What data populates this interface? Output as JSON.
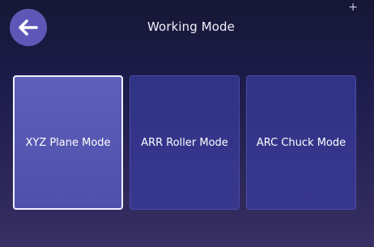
{
  "app": {
    "title": "Working Mode"
  },
  "header": {
    "back_button": {
      "icon": "back-arrow-icon"
    },
    "corner_mark": "+"
  },
  "modes": [
    {
      "label": "XYZ Plane Mode",
      "selected": true
    },
    {
      "label": "ARR Roller Mode",
      "selected": false
    },
    {
      "label": "ARC Chuck Mode",
      "selected": false
    }
  ],
  "colors": {
    "background_top": "#161736",
    "background_bottom": "#392f64",
    "accent": "#5f57b8",
    "card_selected": "#5d5fb9",
    "card_normal": "#303385",
    "text": "#ffffff"
  }
}
